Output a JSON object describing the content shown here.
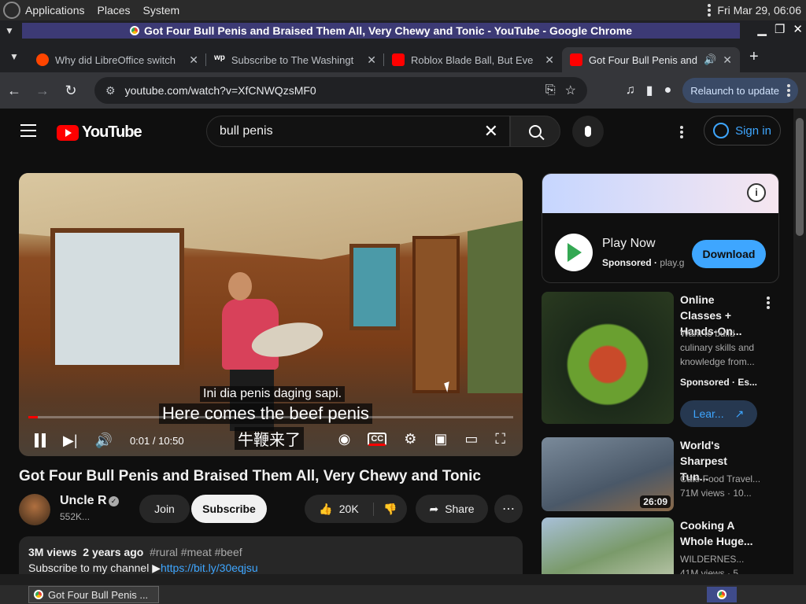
{
  "desktop": {
    "menu": [
      "Applications",
      "Places",
      "System"
    ],
    "clock": "Fri Mar 29, 06:06"
  },
  "window": {
    "title": "Got Four Bull Penis and Braised Them All, Very Chewy and Tonic - YouTube - Google Chrome"
  },
  "tabs": [
    {
      "label": "Why did LibreOffice switch",
      "favicon_color": "#ff4500"
    },
    {
      "label": "Subscribe to The Washingt",
      "favicon_color": "#ffffff",
      "favicon_text": "wp"
    },
    {
      "label": "Roblox Blade Ball, But Eve",
      "favicon_color": "#ff0000"
    },
    {
      "label": "Got Four Bull Penis and",
      "favicon_color": "#ff0000",
      "active": true
    }
  ],
  "toolbar": {
    "url": "youtube.com/watch?v=XfCNWQzsMF0",
    "relaunch": "Relaunch to update"
  },
  "youtube": {
    "logo": "YouTube",
    "search_value": "bull penis",
    "signin": "Sign in",
    "player": {
      "subtitle_top": "Ini dia penis daging sapi.",
      "subtitle_main": "Here comes the beef penis",
      "subtitle_cn": "牛鞭来了",
      "time": "0:01 / 10:50",
      "progress": 0.002,
      "cc": "CC"
    },
    "video_title": "Got Four Bull Penis and Braised Them All, Very Chewy and Tonic",
    "channel": {
      "name": "Uncle Rui",
      "subs": "552K...",
      "join": "Join",
      "subscribe": "Subscribe"
    },
    "actions": {
      "likes": "20K",
      "share": "Share"
    },
    "description": {
      "views": "3M views",
      "ago": "2 years ago",
      "tags": "#rural #meat #beef",
      "line2": "Subscribe to my channel ▶",
      "link": "https://bit.ly/30eqjsu"
    },
    "ad": {
      "title": "Play Now",
      "sponsored": "Sponsored",
      "domain": "play.g",
      "download": "Download"
    },
    "recommendations": [
      {
        "title": "Online Classes + Hands-On...",
        "meta1": "Want to build culinary skills and knowledge from...",
        "meta2": "Sponsored · Es...",
        "learn": "Lear...",
        "duration": ""
      },
      {
        "title": "World's Sharpest Tun...",
        "meta1": "Cate Food Travel...",
        "meta2": "71M views · 10...",
        "duration": "26:09"
      },
      {
        "title": "Cooking A Whole Huge...",
        "meta1": "WILDERNES...",
        "meta2": "41M views · 5...",
        "duration": ""
      }
    ]
  },
  "taskbar": {
    "item": "Got Four Bull Penis ..."
  }
}
